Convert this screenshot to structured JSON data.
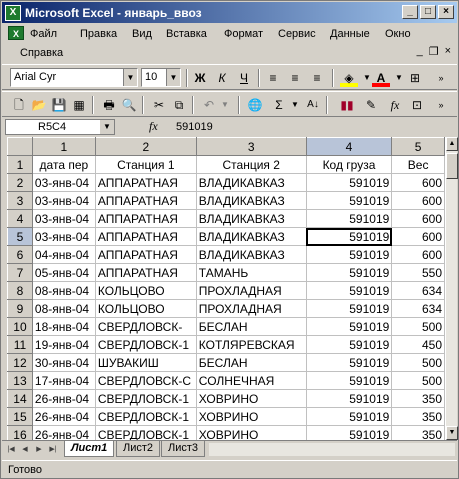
{
  "window": {
    "title": "Microsoft Excel - январь_ввоз",
    "app_icon": "X"
  },
  "menu": {
    "items": [
      "Файл",
      "Правка",
      "Вид",
      "Вставка",
      "Формат",
      "Сервис",
      "Данные",
      "Окно",
      "Справка"
    ]
  },
  "toolbar": {
    "font_name": "Arial Cyr",
    "font_size": "10",
    "bold": "Ж",
    "italic": "К",
    "underline": "Ч",
    "fill_color": "#ffff00",
    "font_color": "#ff0000"
  },
  "formula": {
    "cell_ref": "R5C4",
    "fx": "fx",
    "value": "591019"
  },
  "sheet": {
    "columns": [
      "1",
      "2",
      "3",
      "4",
      "5"
    ],
    "selected_col": "4",
    "selected_row": "5",
    "rows": [
      {
        "n": "1",
        "cells": [
          "дата пер",
          "Станция 1",
          "Станция 2",
          "Код груза",
          "Вес"
        ]
      },
      {
        "n": "2",
        "cells": [
          "03-янв-04",
          "АППАРАТНАЯ",
          "ВЛАДИКАВКАЗ",
          "591019",
          "600"
        ]
      },
      {
        "n": "3",
        "cells": [
          "03-янв-04",
          "АППАРАТНАЯ",
          "ВЛАДИКАВКАЗ",
          "591019",
          "600"
        ]
      },
      {
        "n": "4",
        "cells": [
          "03-янв-04",
          "АППАРАТНАЯ",
          "ВЛАДИКАВКАЗ",
          "591019",
          "600"
        ]
      },
      {
        "n": "5",
        "cells": [
          "03-янв-04",
          "АППАРАТНАЯ",
          "ВЛАДИКАВКАЗ",
          "591019",
          "600"
        ]
      },
      {
        "n": "6",
        "cells": [
          "04-янв-04",
          "АППАРАТНАЯ",
          "ВЛАДИКАВКАЗ",
          "591019",
          "600"
        ]
      },
      {
        "n": "7",
        "cells": [
          "05-янв-04",
          "АППАРАТНАЯ",
          "ТАМАНЬ",
          "591019",
          "550"
        ]
      },
      {
        "n": "8",
        "cells": [
          "08-янв-04",
          "КОЛЬЦОВО",
          "ПРОХЛАДНАЯ",
          "591019",
          "634"
        ]
      },
      {
        "n": "9",
        "cells": [
          "08-янв-04",
          "КОЛЬЦОВО",
          "ПРОХЛАДНАЯ",
          "591019",
          "634"
        ]
      },
      {
        "n": "10",
        "cells": [
          "18-янв-04",
          "СВЕРДЛОВСК-",
          "БЕСЛАН",
          "591019",
          "500"
        ]
      },
      {
        "n": "11",
        "cells": [
          "19-янв-04",
          "СВЕРДЛОВСК-1",
          "КОТЛЯРЕВСКАЯ",
          "591019",
          "450"
        ]
      },
      {
        "n": "12",
        "cells": [
          "30-янв-04",
          "ШУВАКИШ",
          "БЕСЛАН",
          "591019",
          "500"
        ]
      },
      {
        "n": "13",
        "cells": [
          "17-янв-04",
          "СВЕРДЛОВСК-С",
          "СОЛНЕЧНАЯ",
          "591019",
          "500"
        ]
      },
      {
        "n": "14",
        "cells": [
          "26-янв-04",
          "СВЕРДЛОВСК-1",
          "ХОВРИНО",
          "591019",
          "350"
        ]
      },
      {
        "n": "15",
        "cells": [
          "26-янв-04",
          "СВЕРДЛОВСК-1",
          "ХОВРИНО",
          "591019",
          "350"
        ]
      },
      {
        "n": "16",
        "cells": [
          "26-янв-04",
          "СВЕРДЛОВСК-1",
          "ХОВРИНО",
          "591019",
          "350"
        ]
      }
    ]
  },
  "tabs": [
    "Лист1",
    "Лист2",
    "Лист3"
  ],
  "status": "Готово"
}
